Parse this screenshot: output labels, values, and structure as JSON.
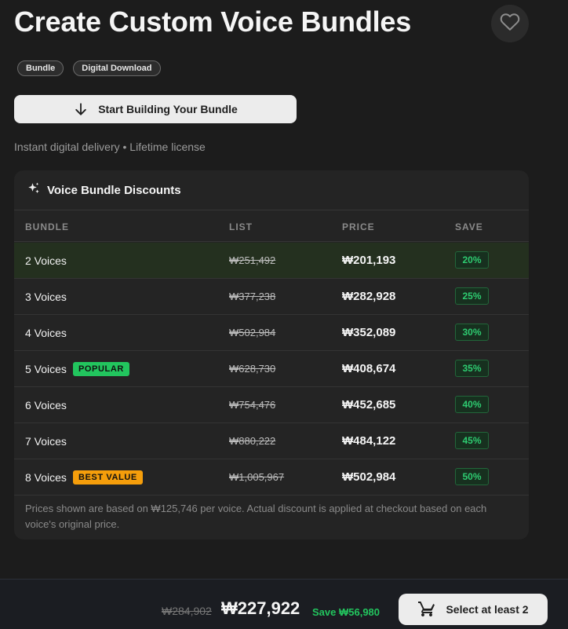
{
  "header": {
    "title": "Create Custom Voice Bundles"
  },
  "tags": [
    "Bundle",
    "Digital Download"
  ],
  "actions": {
    "start_label": "Start Building Your Bundle",
    "favorite_icon": "heart-icon"
  },
  "delivery_text": "Instant digital delivery • Lifetime license",
  "discount_table": {
    "title": "Voice Bundle Discounts",
    "icon": "sparkle-icon",
    "columns": [
      "BUNDLE",
      "LIST",
      "PRICE",
      "SAVE"
    ],
    "rows": [
      {
        "bundle": "2 Voices",
        "badge": "",
        "list_price": "₩251,492",
        "price": "₩201,193",
        "save": "20%"
      },
      {
        "bundle": "3 Voices",
        "badge": "",
        "list_price": "₩377,238",
        "price": "₩282,928",
        "save": "25%"
      },
      {
        "bundle": "4 Voices",
        "badge": "",
        "list_price": "₩502,984",
        "price": "₩352,089",
        "save": "30%"
      },
      {
        "bundle": "5 Voices",
        "badge": "POPULAR",
        "list_price": "₩628,730",
        "price": "₩408,674",
        "save": "35%"
      },
      {
        "bundle": "6 Voices",
        "badge": "",
        "list_price": "₩754,476",
        "price": "₩452,685",
        "save": "40%"
      },
      {
        "bundle": "7 Voices",
        "badge": "",
        "list_price": "₩880,222",
        "price": "₩484,122",
        "save": "45%"
      },
      {
        "bundle": "8 Voices",
        "badge": "BEST VALUE",
        "list_price": "₩1,005,967",
        "price": "₩502,984",
        "save": "50%"
      }
    ],
    "footnote": "Prices shown are based on ₩125,746 per voice. Actual discount is applied at checkout based on each voice's original price."
  },
  "summary": {
    "old_total": "₩284,902",
    "new_total": "₩227,922",
    "save_text": "Save ₩56,980",
    "select_label": "Select at least 2",
    "cart_icon": "cart-icon"
  },
  "colors": {
    "background": "#1c1c1c",
    "card": "#242424",
    "accent_green": "#22c55e",
    "accent_orange": "#f59e0b",
    "button": "#ececec"
  }
}
